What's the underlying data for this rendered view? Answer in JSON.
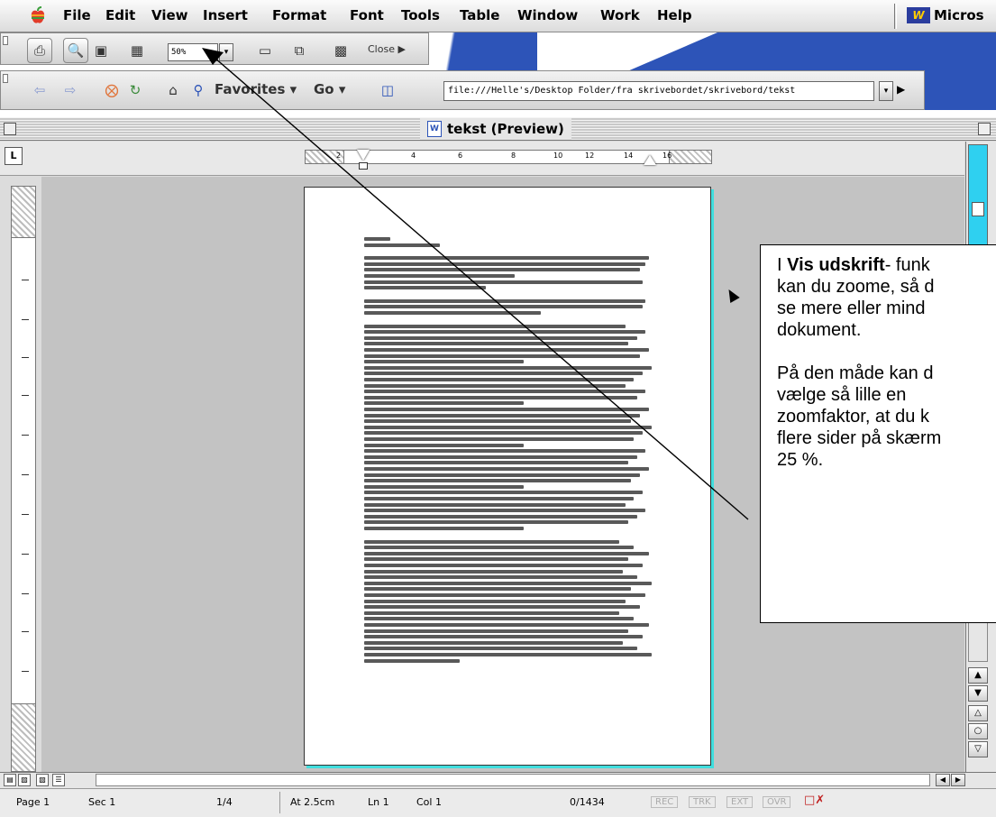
{
  "menubar": {
    "items": [
      "File",
      "Edit",
      "View",
      "Insert",
      "Format",
      "Font",
      "Tools",
      "Table",
      "Window",
      "Work",
      "Help"
    ],
    "app_name": "Micros",
    "app_icon": "W"
  },
  "preview_toolbar": {
    "zoom_value": "50%",
    "close_label": "Close"
  },
  "web_toolbar": {
    "favorites_label": "Favorites",
    "go_label": "Go",
    "address": "file:///Helle's/Desktop Folder/fra skrivebordet/skrivebord/tekst"
  },
  "window": {
    "title": "tekst (Preview)"
  },
  "ruler": {
    "ticks": [
      "2",
      "4",
      "6",
      "8",
      "10",
      "12",
      "14",
      "16"
    ],
    "tab_button": "L"
  },
  "status_bar": {
    "page": "Page 1",
    "section": "Sec 1",
    "page_count": "1/4",
    "at": "At 2.5cm",
    "line": "Ln 1",
    "col": "Col 1",
    "words": "0/1434",
    "modes": [
      "REC",
      "TRK",
      "EXT",
      "OVR"
    ]
  },
  "callout": {
    "lead": "I ",
    "bold": "Vis udskrift",
    "rest": "- funk\nkan du zoome, så d\nse mere eller mind\ndokument.",
    "para2": "På den måde kan d\nvælge så lille en\nzoomfaktor, at du k\nflere sider på skærm\n25 %."
  },
  "colors": {
    "accent_blue": "#2d54b8",
    "scroll_cyan": "#2fd0f0",
    "page_shadow": "#40dede"
  }
}
